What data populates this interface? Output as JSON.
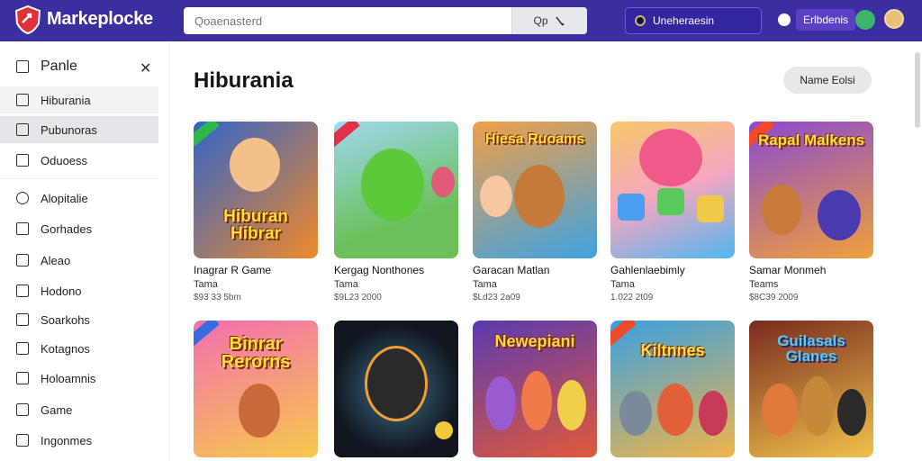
{
  "header": {
    "brand": "Markeplocke",
    "search_placeholder": "Qoaenasterd",
    "search_button": "Qp",
    "status_label": "Uneheraesin",
    "account_label": "Erlbdenis"
  },
  "sidebar": {
    "head": "Panle",
    "items": [
      {
        "label": "Hiburania"
      },
      {
        "label": "Pubunoras"
      },
      {
        "label": "Oduoess"
      },
      {
        "label": "Alopitalie"
      },
      {
        "label": "Gorhades"
      },
      {
        "label": "Aleao"
      },
      {
        "label": "Hodono"
      },
      {
        "label": "Soarkohs"
      },
      {
        "label": "Kotagnos"
      },
      {
        "label": "Holoamnis"
      },
      {
        "label": "Game"
      },
      {
        "label": "Ingonmes"
      }
    ]
  },
  "main": {
    "title": "Hiburania",
    "name_button": "Name Eolsi",
    "cards": [
      {
        "title_art": "Hiburan Hibrar",
        "name": "Inagrar R Game",
        "meta": "Tama",
        "meta2": "$93 33 5bm",
        "colors": [
          "#2f64c8",
          "#f08a2a"
        ]
      },
      {
        "title_art": "",
        "name": "Kergag Nonthones",
        "meta": "Tama",
        "meta2": "$9L23 2000",
        "colors": [
          "#6bc05a",
          "#c4e0f2"
        ]
      },
      {
        "title_art": "Hiesa Ruoams",
        "name": "Garacan Matlan",
        "meta": "Tama",
        "meta2": "$Ld23 2a09",
        "colors": [
          "#e89a3c",
          "#3fa2e0"
        ]
      },
      {
        "title_art": "",
        "name": "Gahlenlaebimly",
        "meta": "Tama",
        "meta2": "1.022 2t09",
        "colors": [
          "#f4a7c0",
          "#4fb7f0"
        ]
      },
      {
        "title_art": "Rapal Malkens",
        "name": "Samar Monmeh",
        "meta": "Teams",
        "meta2": "$8C39 2009",
        "colors": [
          "#7a3cc4",
          "#f0a03a"
        ]
      },
      {
        "title_art": "Binrar Rerorns",
        "name": "",
        "meta": "",
        "meta2": "",
        "colors": [
          "#f05aa0",
          "#f7c94c"
        ]
      },
      {
        "title_art": "",
        "name": "",
        "meta": "",
        "meta2": "",
        "colors": [
          "#10151e",
          "#3d6f8c"
        ]
      },
      {
        "title_art": "Newepiani",
        "name": "",
        "meta": "",
        "meta2": "",
        "colors": [
          "#6a3ac4",
          "#e05a3a"
        ]
      },
      {
        "title_art": "Kiltnnes",
        "name": "",
        "meta": "",
        "meta2": "",
        "colors": [
          "#3aa0e0",
          "#f0b54a"
        ]
      },
      {
        "title_art": "Guilasals Glanes",
        "name": "",
        "meta": "",
        "meta2": "",
        "colors": [
          "#b84a1e",
          "#f0c24c"
        ]
      }
    ]
  }
}
